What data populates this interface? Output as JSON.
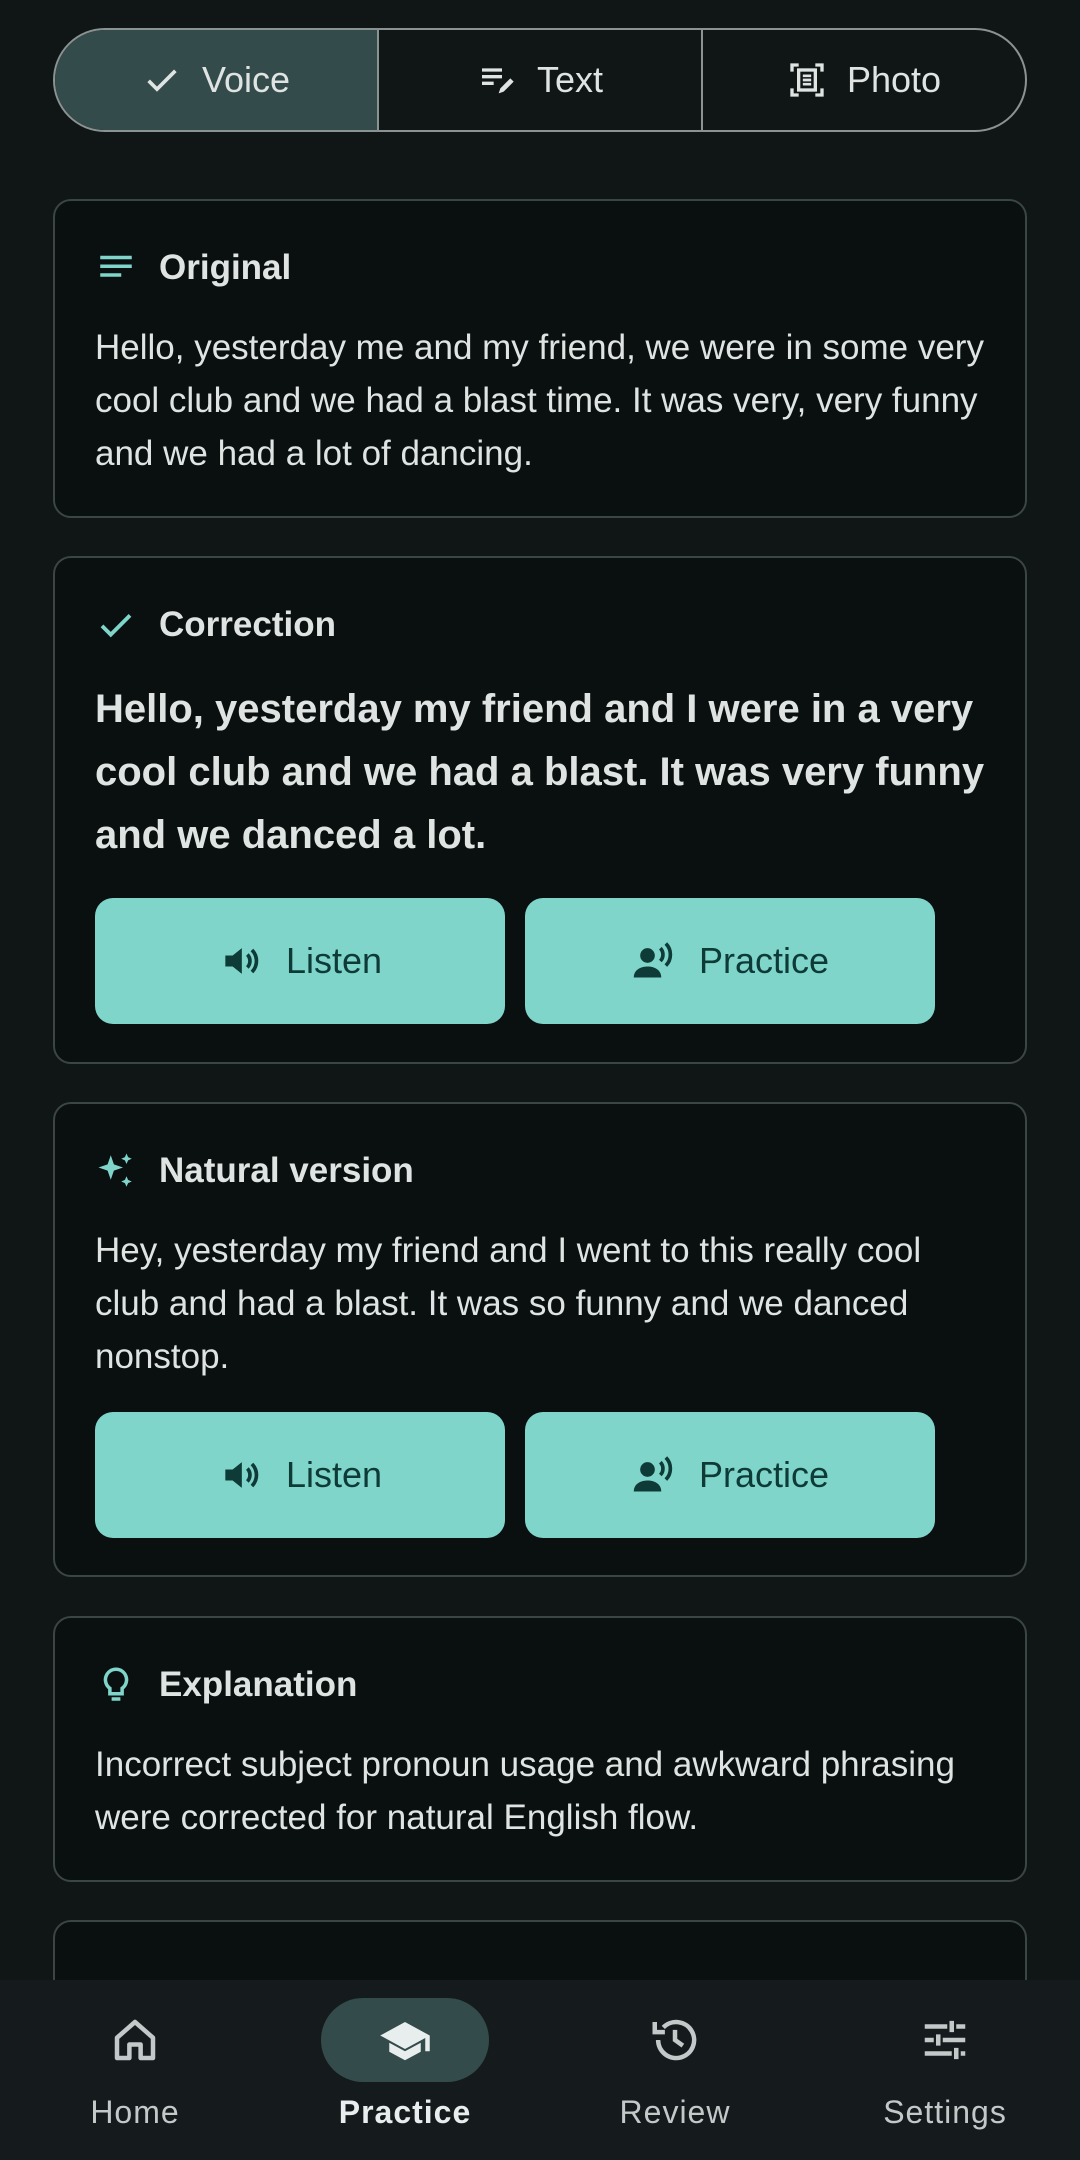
{
  "input_modes": {
    "voice": "Voice",
    "text": "Text",
    "photo": "Photo",
    "selected": "Voice"
  },
  "original": {
    "title": "Original",
    "text": "Hello, yesterday me and my friend, we were in some very cool club and we had a blast time. It was very, very funny and we had a lot of dancing."
  },
  "correction": {
    "title": "Correction",
    "text": "Hello, yesterday my friend and I were in a very cool club and we had a blast. It was very funny and we danced a lot.",
    "listen_label": "Listen",
    "practice_label": "Practice"
  },
  "natural": {
    "title": "Natural version",
    "text": "Hey, yesterday my friend and I went to this really cool club and had a blast. It was so funny and we danced nonstop.",
    "listen_label": "Listen",
    "practice_label": "Practice"
  },
  "explanation": {
    "title": "Explanation",
    "text": "Incorrect subject pronoun usage and awkward phrasing were corrected for natural English flow."
  },
  "nav": {
    "home": "Home",
    "practice": "Practice",
    "review": "Review",
    "settings": "Settings",
    "active": "Practice"
  },
  "colors": {
    "background": "#101516",
    "card": "#0a0f10",
    "accent": "#80d5cb",
    "accent_text": "#0e3b37",
    "selected_pill": "#334b4a"
  }
}
